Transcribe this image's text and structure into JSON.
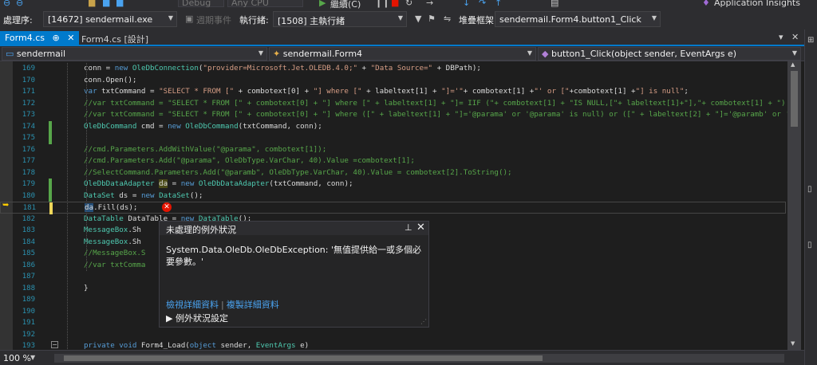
{
  "toolbar_top": {
    "config": "Debug",
    "platform": "Any CPU",
    "continue_label": "繼續(C)",
    "app_insights": "Application Insights"
  },
  "toolbar_debug": {
    "process_label": "處理序:",
    "process_value": "[14672] sendermail.exe",
    "lifecycle_label": "週期事件",
    "thread_label": "執行緒:",
    "thread_value": "[1508] 主執行緒",
    "stack_label": "堆疊框架:",
    "stack_value": "sendermail.Form4.button1_Click"
  },
  "tabs": [
    {
      "label": "Form4.cs",
      "pin": "⊕",
      "close": "✕"
    },
    {
      "label": "Form4.cs [設計]"
    }
  ],
  "navbar": {
    "project": "sendermail",
    "class": "sendermail.Form4",
    "member": "button1_Click(object sender, EventArgs e)"
  },
  "code_lines": [
    {
      "n": "169",
      "segs": [
        [
          "",
          "conn = "
        ],
        [
          "kw",
          "new "
        ],
        [
          "ty",
          "OleDbConnection"
        ],
        [
          "",
          "("
        ],
        [
          "st",
          "\"provider=Microsoft.Jet.OLEDB.4.0;\""
        ],
        [
          "",
          " + "
        ],
        [
          "st",
          "\"Data Source=\""
        ],
        [
          "",
          " + DBPath);"
        ]
      ]
    },
    {
      "n": "170",
      "segs": [
        [
          "",
          "conn.Open();"
        ]
      ]
    },
    {
      "n": "171",
      "segs": [
        [
          "kw",
          "var "
        ],
        [
          "",
          "txtCommand = "
        ],
        [
          "st",
          "\"SELECT * FROM [\""
        ],
        [
          "",
          " + combotext[0] + "
        ],
        [
          "st",
          "\"] where [\""
        ],
        [
          "",
          " + labeltext[1] + "
        ],
        [
          "st",
          "\"]='\""
        ],
        [
          "",
          "+ combotext[1] +"
        ],
        [
          "st",
          "\"' or [\""
        ],
        [
          "",
          "+combotext[1] +"
        ],
        [
          "st",
          "\"] is null\""
        ],
        [
          "",
          ";"
        ]
      ]
    },
    {
      "n": "172",
      "segs": [
        [
          "cm",
          "//var txtCommand = \"SELECT * FROM [\" + combotext[0] + \"] where [\" + labeltext[1] + \"]= IIF (\"+ combotext[1] + \"IS NULL,[\"+ labeltext[1]+\"],\"+ combotext[1] + \")"
        ]
      ]
    },
    {
      "n": "173",
      "segs": [
        [
          "cm",
          "//var txtCommand = \"SELECT * FROM [\" + combotext[0] + \"] where ([\" + labeltext[1] + \"]='@parama' or '@parama' is null) or ([\" + labeltext[2] + \"]='@paramb' or '"
        ]
      ]
    },
    {
      "n": "174",
      "segs": [
        [
          "ty",
          "OleDbCommand"
        ],
        [
          "",
          " cmd = "
        ],
        [
          "kw",
          "new "
        ],
        [
          "ty",
          "OleDbCommand"
        ],
        [
          "",
          "(txtCommand, conn);"
        ]
      ]
    },
    {
      "n": "175",
      "segs": []
    },
    {
      "n": "176",
      "segs": [
        [
          "cm",
          "//cmd.Parameters.AddWithValue(\"@parama\", combotext[1]);"
        ]
      ]
    },
    {
      "n": "177",
      "segs": [
        [
          "cm",
          "//cmd.Parameters.Add(\"@parama\", OleDbType.VarChar, 40).Value =combotext[1];"
        ]
      ]
    },
    {
      "n": "178",
      "segs": [
        [
          "cm",
          "//SelectCommand.Parameters.Add(\"@paramb\", OleDbType.VarChar, 40).Value = combotext[2].ToString();"
        ]
      ]
    },
    {
      "n": "179",
      "segs": [
        [
          "ty",
          "OleDbDataAdapter"
        ],
        [
          "",
          " "
        ],
        [
          "hlg",
          "da"
        ],
        [
          "",
          " = "
        ],
        [
          "kw",
          "new "
        ],
        [
          "ty",
          "OleDbDataAdapter"
        ],
        [
          "",
          "(txtCommand, conn);"
        ]
      ]
    },
    {
      "n": "180",
      "segs": [
        [
          "ty",
          "DataSet"
        ],
        [
          "",
          " ds = "
        ],
        [
          "kw",
          "new "
        ],
        [
          "ty",
          "DataSet"
        ],
        [
          "",
          "();"
        ]
      ]
    },
    {
      "n": "181",
      "segs": [
        [
          "hl",
          "da"
        ],
        [
          "",
          ".Fill(ds);"
        ]
      ]
    },
    {
      "n": "182",
      "segs": [
        [
          "ty",
          "DataTable"
        ],
        [
          "",
          " DataTable = "
        ],
        [
          "kw",
          "new "
        ],
        [
          "ty",
          "DataTable"
        ],
        [
          "",
          "();"
        ]
      ]
    },
    {
      "n": "183",
      "segs": [
        [
          "ty",
          "MessageBox"
        ],
        [
          "",
          ".Sh"
        ]
      ]
    },
    {
      "n": "184",
      "segs": [
        [
          "ty",
          "MessageBox"
        ],
        [
          "",
          ".Sh"
        ]
      ]
    },
    {
      "n": "185",
      "segs": [
        [
          "cm",
          "//MessageBox.S"
        ]
      ]
    },
    {
      "n": "186",
      "segs": [
        [
          "cm",
          "//var txtComma"
        ]
      ]
    },
    {
      "n": "187",
      "segs": []
    },
    {
      "n": "188",
      "segs": [
        [
          "",
          "}"
        ]
      ]
    },
    {
      "n": "189",
      "segs": []
    },
    {
      "n": "190",
      "segs": []
    },
    {
      "n": "191",
      "segs": []
    },
    {
      "n": "192",
      "segs": []
    },
    {
      "n": "193",
      "segs": [
        [
          "kw",
          "private void "
        ],
        [
          "",
          "Form4_Load("
        ],
        [
          "kw",
          "object "
        ],
        [
          "",
          "sender, "
        ],
        [
          "ty",
          "EventArgs"
        ],
        [
          "",
          " e)"
        ]
      ]
    }
  ],
  "exception": {
    "title": "未處理的例外狀況",
    "message": "System.Data.OleDb.OleDbException: '無值提供給一或多個必要參數。'",
    "link_view": "檢視詳細資料",
    "link_copy": "複製詳細資料",
    "settings": "例外狀況設定"
  },
  "status": {
    "zoom": "100 %"
  },
  "colors": {
    "accent": "#007acc",
    "error": "#e51400",
    "change_saved": "#57a64a",
    "change_unsaved": "#efd75a"
  }
}
